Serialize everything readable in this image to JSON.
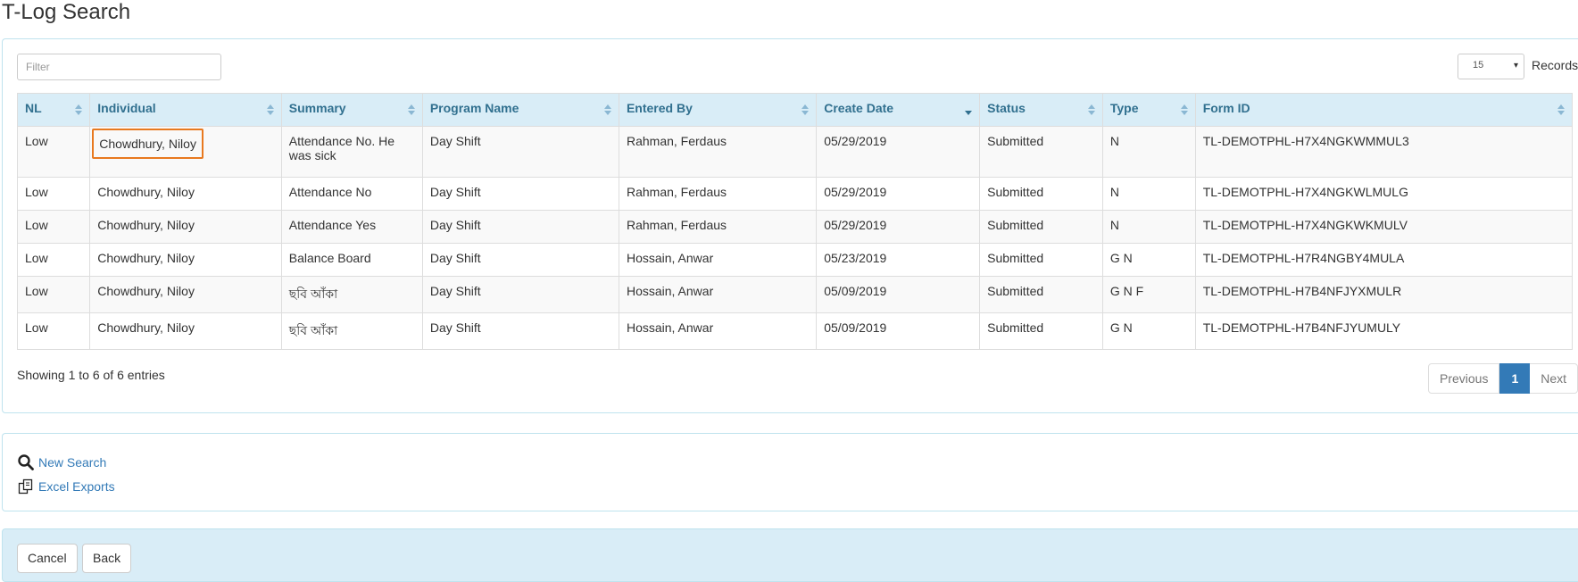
{
  "page": {
    "title": "T-Log Search"
  },
  "filter": {
    "placeholder": "Filter",
    "value": ""
  },
  "records": {
    "selected": "15",
    "label": "Records"
  },
  "table": {
    "columns": [
      "NL",
      "Individual",
      "Summary",
      "Program Name",
      "Entered By",
      "Create Date",
      "Status",
      "Type",
      "Form ID"
    ],
    "sorted_column": "Create Date",
    "rows": [
      [
        "Low",
        "Chowdhury, Niloy",
        "Attendance No. He was sick",
        "Day Shift",
        "Rahman, Ferdaus",
        "05/29/2019",
        "Submitted",
        "N",
        "TL-DEMOTPHL-H7X4NGKWMMUL3"
      ],
      [
        "Low",
        "Chowdhury, Niloy",
        "Attendance No",
        "Day Shift",
        "Rahman, Ferdaus",
        "05/29/2019",
        "Submitted",
        "N",
        "TL-DEMOTPHL-H7X4NGKWLMULG"
      ],
      [
        "Low",
        "Chowdhury, Niloy",
        "Attendance Yes",
        "Day Shift",
        "Rahman, Ferdaus",
        "05/29/2019",
        "Submitted",
        "N",
        "TL-DEMOTPHL-H7X4NGKWKMULV"
      ],
      [
        "Low",
        "Chowdhury, Niloy",
        "Balance Board",
        "Day Shift",
        "Hossain, Anwar",
        "05/23/2019",
        "Submitted",
        "G N",
        "TL-DEMOTPHL-H7R4NGBY4MULA"
      ],
      [
        "Low",
        "Chowdhury, Niloy",
        "ছবি আঁকা",
        "Day Shift",
        "Hossain, Anwar",
        "05/09/2019",
        "Submitted",
        "G N F",
        "TL-DEMOTPHL-H7B4NFJYXMULR"
      ],
      [
        "Low",
        "Chowdhury, Niloy",
        "ছবি আঁকা",
        "Day Shift",
        "Hossain, Anwar",
        "05/09/2019",
        "Submitted",
        "G N",
        "TL-DEMOTPHL-H7B4NFJYUMULY"
      ]
    ]
  },
  "info": {
    "showing": "Showing 1 to 6 of 6 entries"
  },
  "pagination": {
    "previous": "Previous",
    "current": "1",
    "next": "Next"
  },
  "links": {
    "new_search": "New Search",
    "excel_exports": "Excel Exports"
  },
  "actions": {
    "cancel": "Cancel",
    "back": "Back"
  },
  "colors": {
    "header_bg": "#d9edf7",
    "header_text": "#31708f",
    "link": "#337ab7",
    "highlight": "#e8791f"
  },
  "icons": {
    "new_search": "search-icon",
    "excel_exports": "copy-icon"
  }
}
